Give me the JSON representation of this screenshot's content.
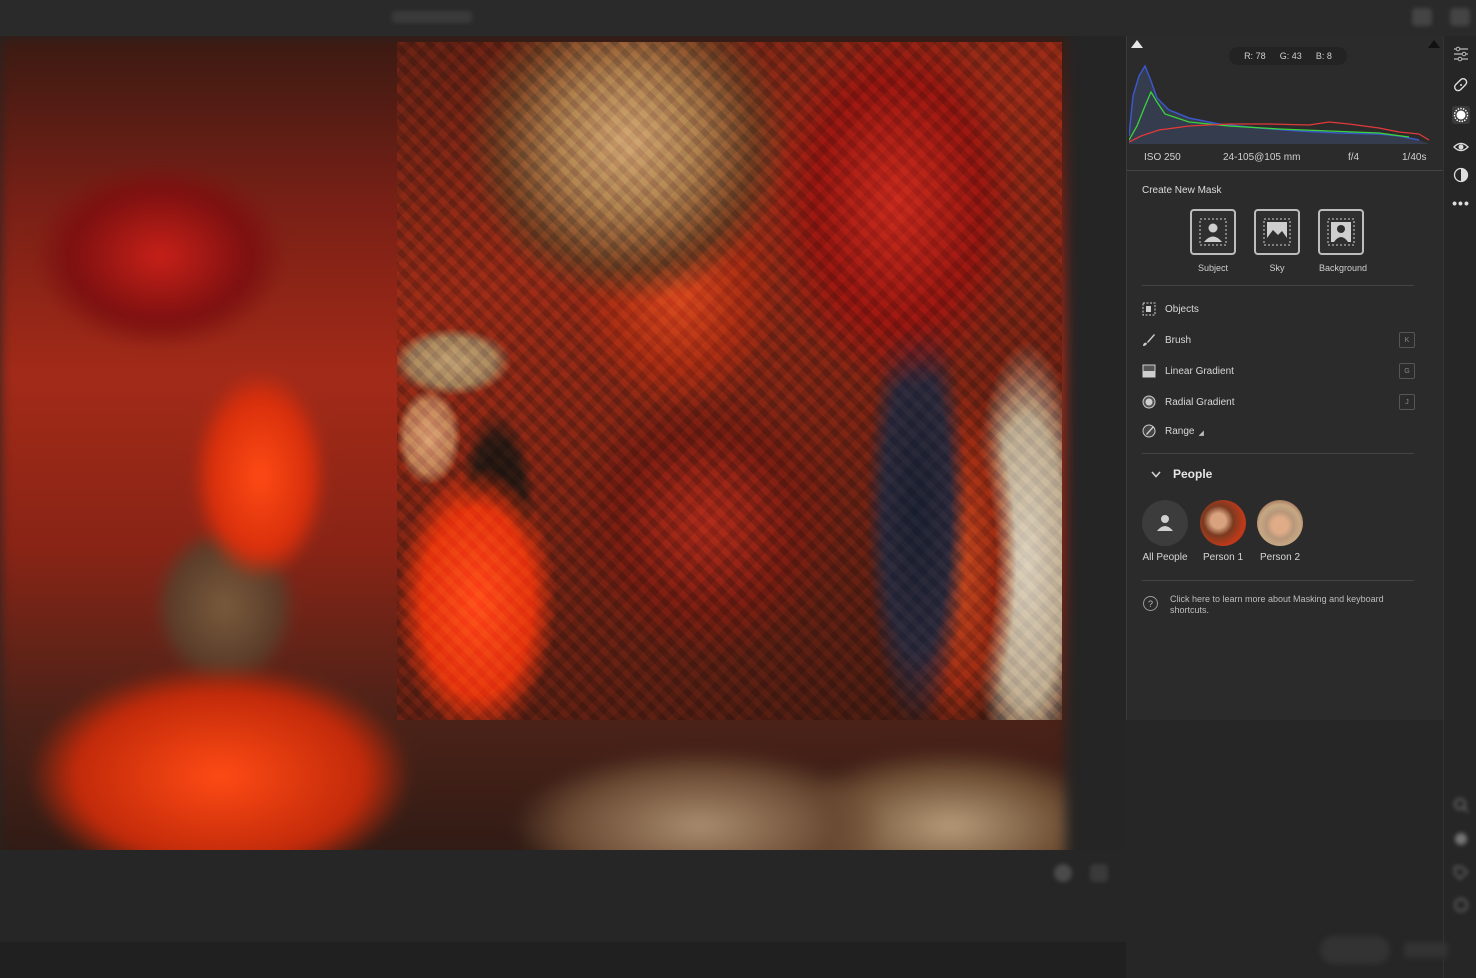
{
  "histogram": {
    "readout": {
      "r": "R: 78",
      "g": "G: 43",
      "b": "B: 8"
    }
  },
  "camera_info": {
    "iso": "ISO 250",
    "lens": "24-105@105 mm",
    "aperture": "f/4",
    "shutter": "1/40s"
  },
  "create_mask": {
    "title": "Create New Mask",
    "buttons": [
      {
        "label": "Subject",
        "icon": "subject-icon"
      },
      {
        "label": "Sky",
        "icon": "sky-icon"
      },
      {
        "label": "Background",
        "icon": "background-icon"
      }
    ]
  },
  "tools": [
    {
      "label": "Objects",
      "icon": "objects-icon",
      "shortcut": ""
    },
    {
      "label": "Brush",
      "icon": "brush-icon",
      "shortcut": "K"
    },
    {
      "label": "Linear Gradient",
      "icon": "linear-gradient-icon",
      "shortcut": "G"
    },
    {
      "label": "Radial Gradient",
      "icon": "radial-gradient-icon",
      "shortcut": "J"
    },
    {
      "label": "Range",
      "icon": "range-icon",
      "shortcut": ""
    }
  ],
  "people": {
    "title": "People",
    "items": [
      {
        "label": "All People"
      },
      {
        "label": "Person 1"
      },
      {
        "label": "Person 2"
      }
    ]
  },
  "help": {
    "text": "Click here to learn more about Masking and keyboard shortcuts."
  },
  "colors": {
    "panel_bg": "#2b2b2b",
    "accent_red": "#e13a1a"
  }
}
